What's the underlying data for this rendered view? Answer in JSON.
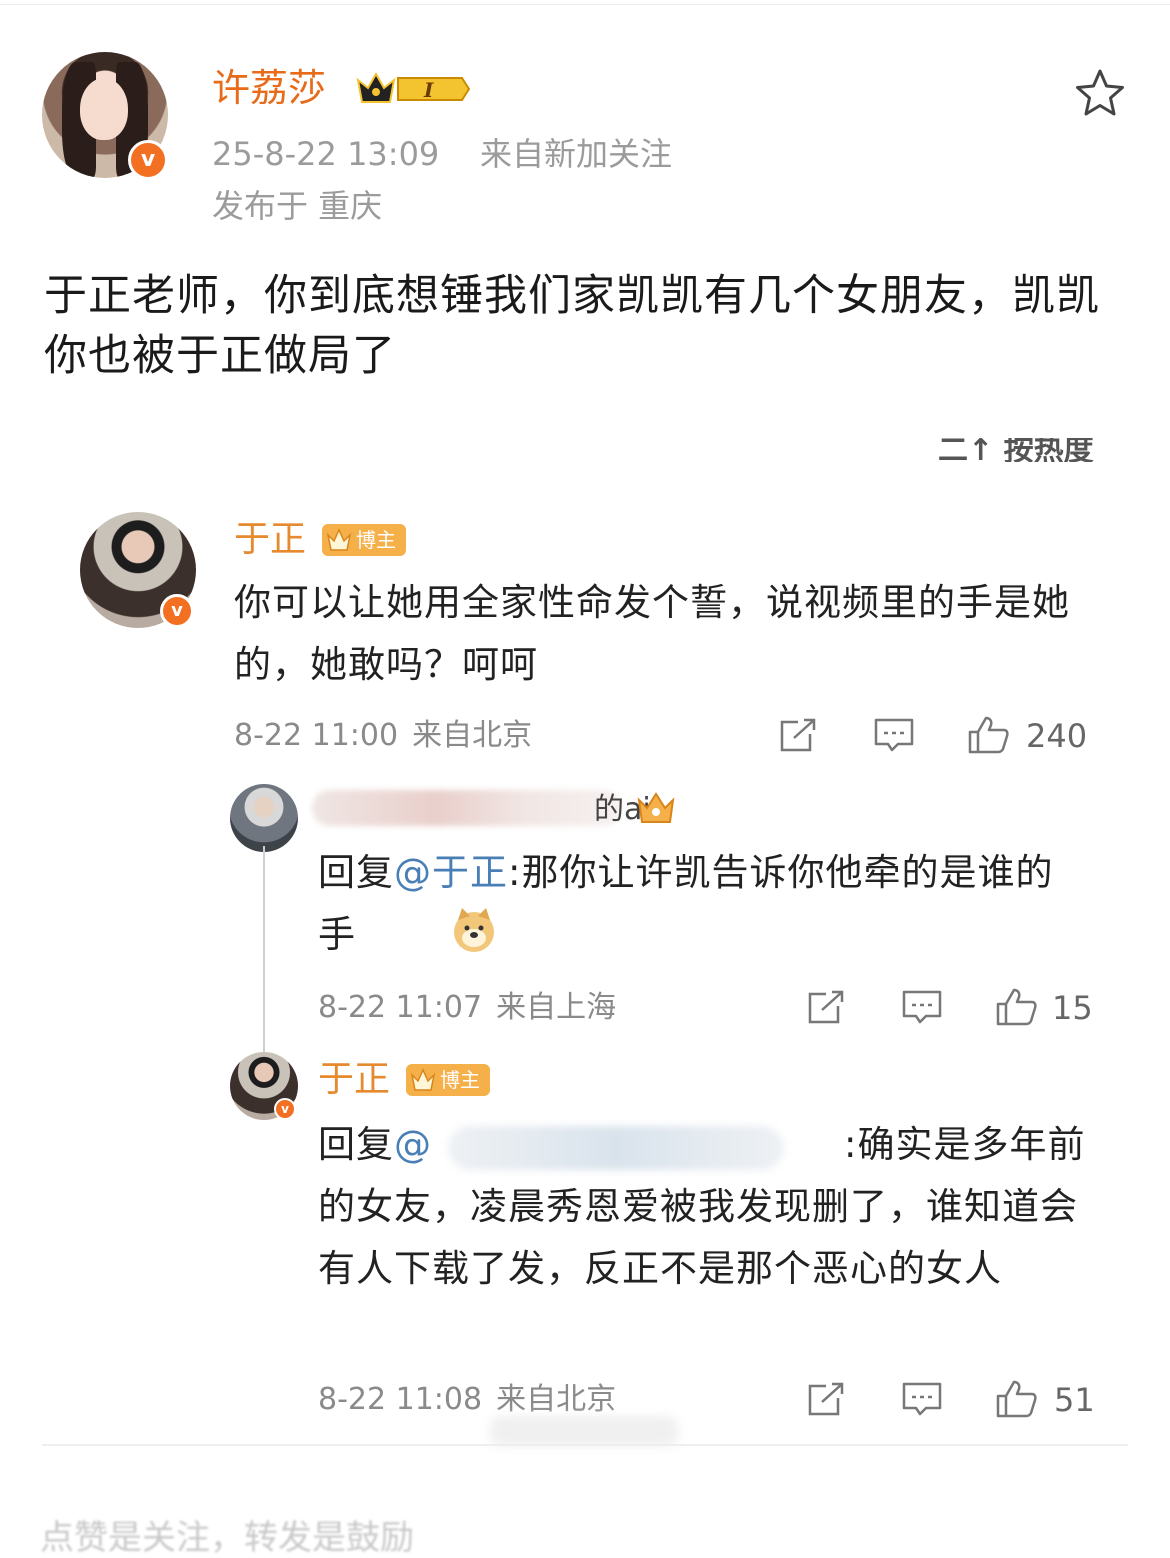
{
  "post": {
    "author": "许荔莎",
    "level_badge": "I",
    "time": "25-8-22 13:09",
    "source": "来自新加关注",
    "location": "发布于 重庆",
    "text": "于正老师，你到底想锤我们家凯凯有几个女朋友，凯凯你也被于正做局了"
  },
  "screenshot": {
    "sort_label": "二↑ 按热度",
    "comment1": {
      "name": "于正",
      "badge": "博主",
      "text": "你可以让她用全家性命发个誓，说视频里的手是她的，她敢吗？呵呵",
      "time": "8-22 11:00",
      "source": "来自北京",
      "likes": "240"
    },
    "reply1": {
      "name_visible": "的ai",
      "prefix": "回复",
      "mention": "@于正",
      "text": ":那你让许凯告诉你他牵的是谁的手",
      "time": "8-22 11:07",
      "source": "来自上海",
      "likes": "15"
    },
    "reply2": {
      "name": "于正",
      "badge": "博主",
      "prefix": "回复",
      "mention": "@",
      "text": ":确实是多年前的女友，凌晨秀恩爱被我发现删了，谁知道会有人下载了发，反正不是那个恶心的女人",
      "time": "8-22 11:08",
      "source": "来自北京",
      "likes": "51"
    }
  },
  "footer_hint": "点赞是关注，转发是鼓励",
  "colors": {
    "username": "#e86b1a",
    "verified": "#f36f21",
    "badge": "#f6b04a",
    "mention": "#4a7fb5"
  }
}
